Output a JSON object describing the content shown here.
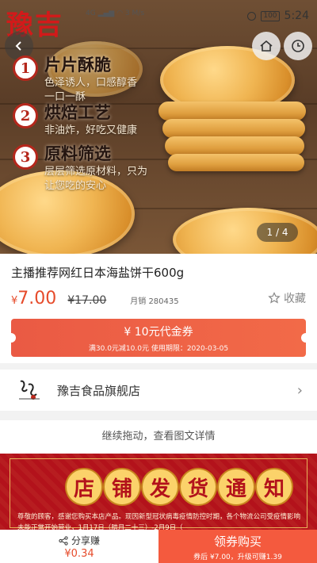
{
  "status_bar": {
    "brand": "豫吉",
    "network": "4G",
    "speed": "3 M/s",
    "battery": "100",
    "time": "5:24"
  },
  "hero": {
    "features": [
      {
        "num": "1",
        "title": "片片酥脆",
        "desc": [
          "色泽诱人，口感醇香",
          "一口一酥"
        ]
      },
      {
        "num": "2",
        "title": "烘焙工艺",
        "desc": [
          "非油炸，好吃又健康"
        ]
      },
      {
        "num": "3",
        "title": "原料筛选",
        "desc": [
          "层层筛选原材料，只为",
          "让您吃的安心"
        ]
      }
    ],
    "pager": "1 / 4"
  },
  "product": {
    "title": "主播推荐网红日本海盐饼干600g",
    "currency": "¥",
    "price": "7.00",
    "original_price": "¥17.00",
    "monthly_sales": "月销 280435",
    "favorite_label": "收藏"
  },
  "coupon": {
    "amount": "¥ 10元代金券",
    "condition": "满30.0元减10.0元 使用期限：2020-03-05"
  },
  "shop": {
    "name": "豫吉食品旗舰店"
  },
  "continue_hint": "继续拖动，查看图文详情",
  "notice": {
    "title_chars": [
      "店",
      "铺",
      "发",
      "货",
      "通",
      "知"
    ],
    "text": "尊敬的顾客，感谢您购买本店产品。现因新型冠状病毒疫情防控时期，各个物流公司受疫情影响未能正常开始营业，1月17日（腊月二十三）-2月9日（"
  },
  "bottom_bar": {
    "share_label": "分享赚",
    "share_amount": "¥0.34",
    "buy_label": "领券购买",
    "buy_detail": "券后 ¥7.00，升级可赚1.39"
  },
  "colors": {
    "accent": "#e64b2b",
    "coupon": "#f26a48",
    "banner": "#b3121b"
  }
}
